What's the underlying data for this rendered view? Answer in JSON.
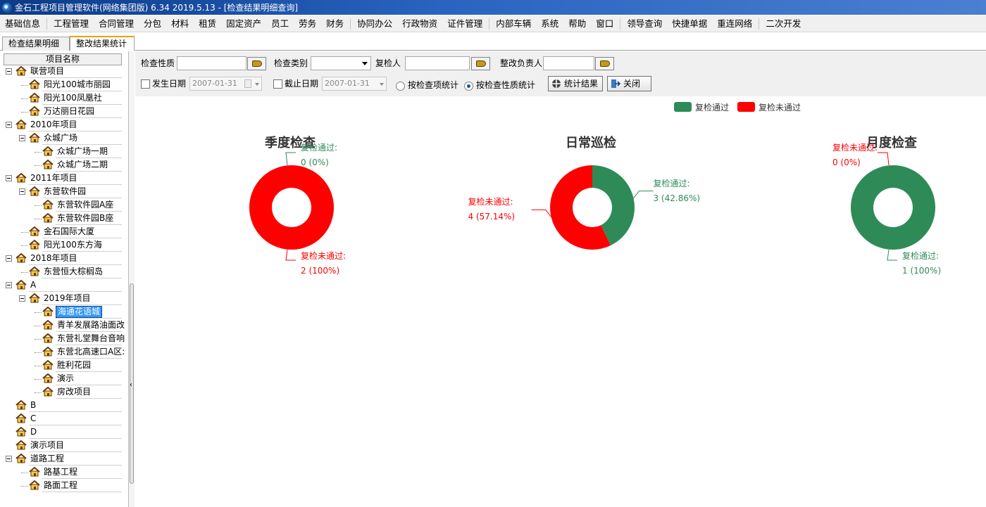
{
  "window": {
    "title": "金石工程项目管理软件(网络集团版) 6.34  2019.5.13 - [检查结果明细查询]"
  },
  "menu": [
    "基础信息",
    "工程管理",
    "合同管理",
    "分包",
    "材料",
    "租赁",
    "固定资产",
    "员工",
    "劳务",
    "财务",
    "协同办公",
    "行政物资",
    "证件管理",
    "内部车辆",
    "系统",
    "帮助",
    "窗口",
    "领导查询",
    "快捷单据",
    "重连网络",
    "二次开发"
  ],
  "tabs": [
    "检查结果明细",
    "整改结果统计"
  ],
  "tree": {
    "header": "项目名称",
    "nodes": [
      "联营项目",
      "阳光100城市丽园",
      "阳光100凤凰社",
      "万达丽日花园",
      "2010年项目",
      "众城广场",
      "众城广场一期",
      "众城广场二期",
      "2011年项目",
      "东营软件园",
      "东营软件园A座",
      "东营软件园B座",
      "金石国际大厦",
      "阳光100东方海",
      "2018年项目",
      "东营恒大棕榈岛",
      "A",
      "2019年项目",
      "海通花语城",
      "青羊发展路油面改",
      "东营礼堂舞台音响",
      "东营北高速口A区:",
      "胜利花园",
      "演示",
      "房改项目",
      "B",
      "C",
      "D",
      "演示项目",
      "道路工程",
      "路基工程",
      "路面工程"
    ]
  },
  "filters": {
    "nature_label": "检查性质",
    "nature_value": "",
    "category_label": "检查类别",
    "category_value": "",
    "rechecker_label": "复检人",
    "rechecker_value": "",
    "rectifier_label": "整改负责人",
    "rectifier_value": "",
    "start_label": "发生日期",
    "start_value": "2007-01-31",
    "end_label": "截止日期",
    "end_value": "2007-01-31",
    "radio_by_item": "按检查项统计",
    "radio_by_nature": "按检查性质统计",
    "stats_button": "统计结果",
    "close_button": "关闭"
  },
  "colors": {
    "pass": "#2e8b57",
    "fail": "#ff0000"
  },
  "chart_data": {
    "type": "pie",
    "legend": [
      {
        "name": "复检通过",
        "color": "#2e8b57"
      },
      {
        "name": "复检未通过",
        "color": "#ff0000"
      }
    ],
    "legend_position": "top-right",
    "charts": [
      {
        "title": "季度检查",
        "slices": [
          {
            "name": "复检通过",
            "value": 0,
            "label_name": "复检通过:",
            "label_value": "0 (0%)"
          },
          {
            "name": "复检未通过",
            "value": 2,
            "label_name": "复检未通过:",
            "label_value": "2 (100%)"
          }
        ]
      },
      {
        "title": "日常巡检",
        "slices": [
          {
            "name": "复检通过",
            "value": 3,
            "label_name": "复检通过:",
            "label_value": "3 (42.86%)"
          },
          {
            "name": "复检未通过",
            "value": 4,
            "label_name": "复检未通过:",
            "label_value": "4 (57.14%)"
          }
        ]
      },
      {
        "title": "月度检查",
        "slices": [
          {
            "name": "复检通过",
            "value": 1,
            "label_name": "复检通过:",
            "label_value": "1 (100%)"
          },
          {
            "name": "复检未通过",
            "value": 0,
            "label_name": "复检未通过:",
            "label_value": "0 (0%)"
          }
        ]
      }
    ]
  }
}
